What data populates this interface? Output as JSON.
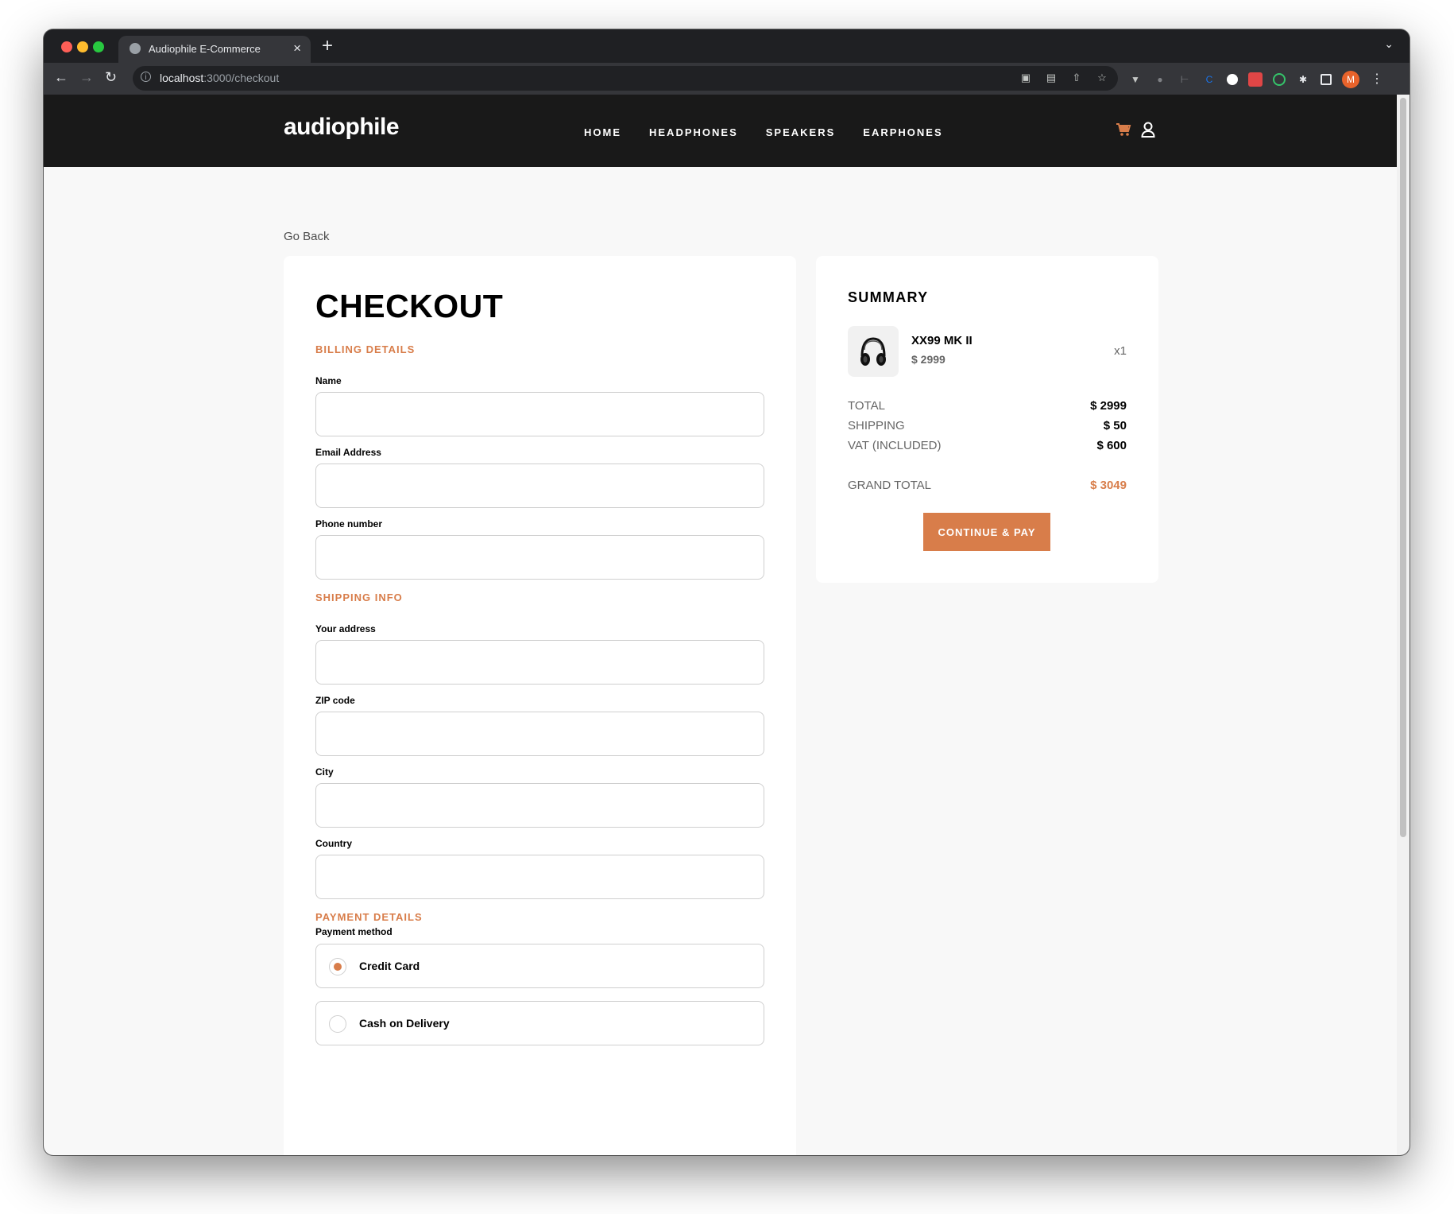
{
  "browser": {
    "tab_title": "Audiophile E-Commerce",
    "tab_close": "×",
    "new_tab": "+",
    "url_host": "localhost",
    "url_rest": ":3000/checkout",
    "profile_initial": "M"
  },
  "header": {
    "logo": "audiophile",
    "nav": [
      "HOME",
      "HEADPHONES",
      "SPEAKERS",
      "EARPHONES"
    ],
    "accent_color": "#d87d4a"
  },
  "page": {
    "go_back": "Go Back",
    "checkout_title": "CHECKOUT",
    "billing_label": "BILLING DETAILS",
    "name_label": "Name",
    "email_label": "Email Address",
    "phone_label": "Phone number",
    "shipping_label": "SHIPPING INFO",
    "address_label": "Your address",
    "zip_label": "ZIP code",
    "city_label": "City",
    "country_label": "Country",
    "payment_label": "PAYMENT DETAILS",
    "payment_method_label": "Payment method",
    "payment_options": [
      "Credit Card",
      "Cash on Delivery"
    ],
    "selected_payment": "Credit Card"
  },
  "summary": {
    "title": "SUMMARY",
    "item_name": "XX99 MK II",
    "item_price": "$ 2999",
    "item_qty": "x1",
    "total_label": "TOTAL",
    "total_value": "$ 2999",
    "shipping_label": "SHIPPING",
    "shipping_value": "$ 50",
    "vat_label": "VAT (INCLUDED)",
    "vat_value": "$ 600",
    "grand_total_label": "GRAND TOTAL",
    "grand_total_value": "$ 3049",
    "pay_button": "CONTINUE & PAY"
  }
}
